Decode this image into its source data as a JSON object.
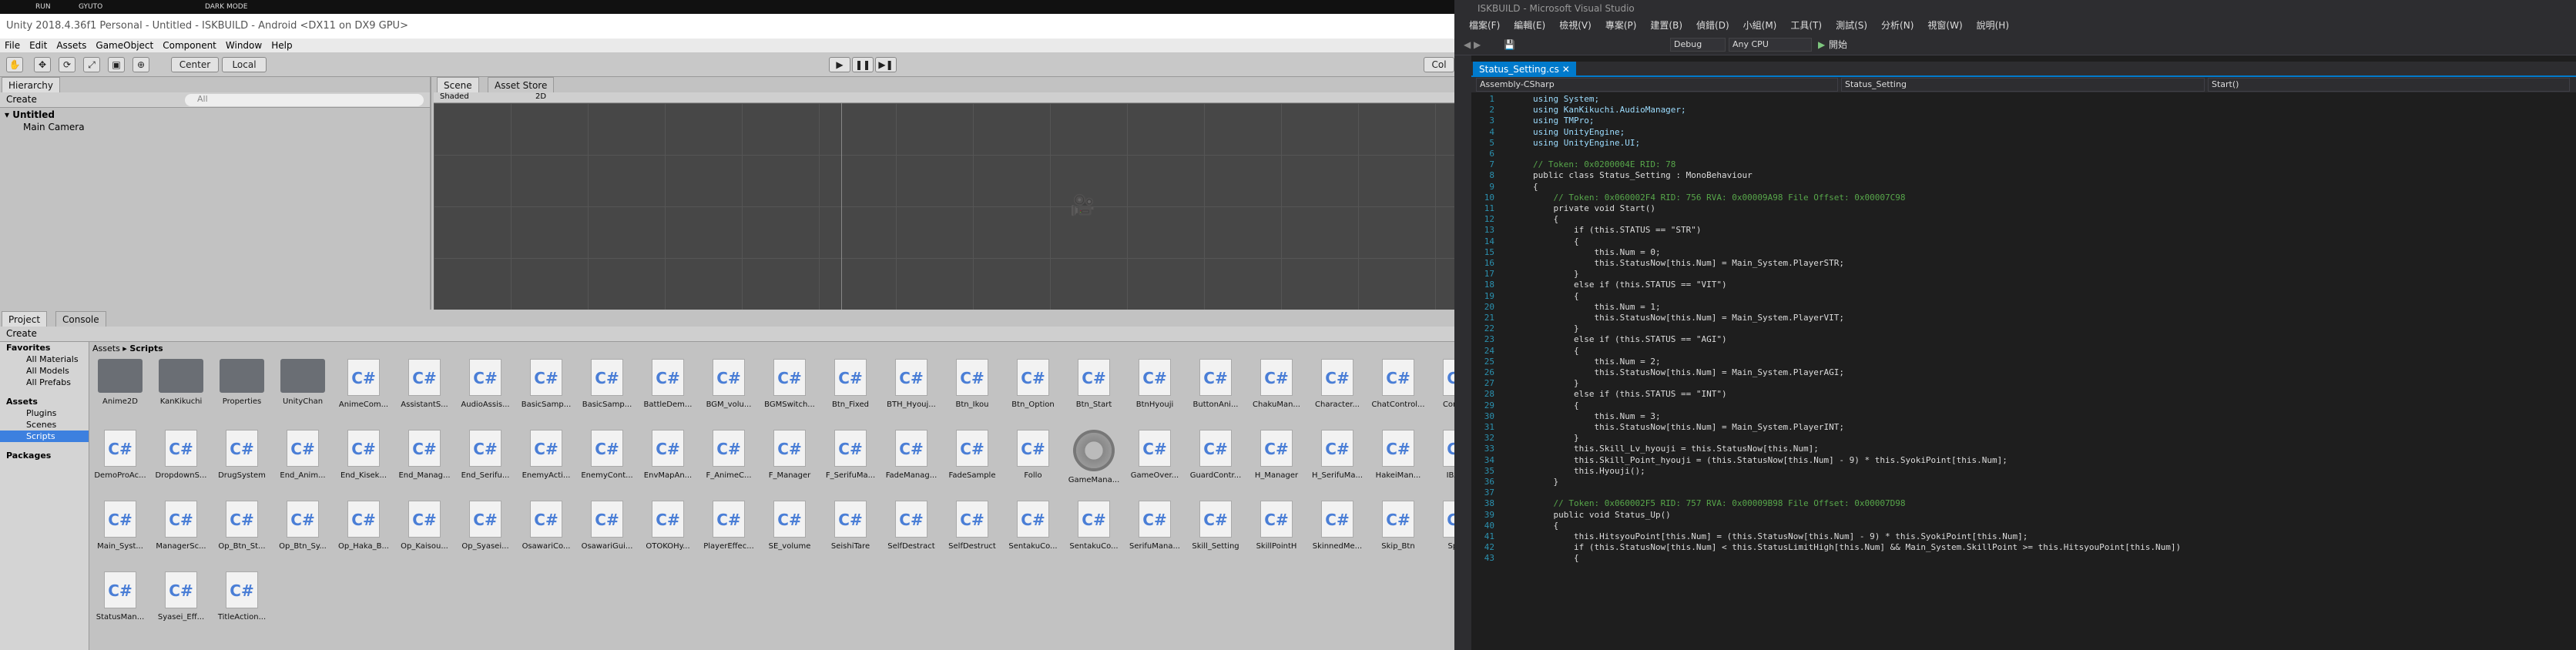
{
  "desktop": {
    "icon_labels": [
      "RUN",
      "GYUTO",
      "",
      "",
      "DARK MODE"
    ]
  },
  "unity": {
    "title": "Unity 2018.4.36f1 Personal - Untitled - ISKBUILD - Android <DX11 on DX9 GPU>",
    "menu": [
      "File",
      "Edit",
      "Assets",
      "GameObject",
      "Component",
      "Window",
      "Help"
    ],
    "toolbar": {
      "center": "Center",
      "local": "Local",
      "collab": "Col"
    },
    "hierarchy": {
      "tab": "Hierarchy",
      "create": "Create",
      "search": "All",
      "scene": "Untitled",
      "items": [
        "Main Camera"
      ]
    },
    "scene": {
      "tab": "Scene",
      "tab2": "Asset Store",
      "shading": "Shaded",
      "mode": "2D"
    },
    "project": {
      "tab": "Project",
      "tab2": "Console",
      "create": "Create",
      "tree": [
        "Favorites",
        "All Materials",
        "All Models",
        "All Prefabs",
        "Assets",
        "Plugins",
        "Scenes",
        "Scripts",
        "Packages"
      ],
      "breadcrumb": [
        "Assets",
        "Scripts"
      ],
      "assets": [
        [
          "Anime2D",
          "KanKikuchi",
          "Properties",
          "UnityChan",
          "AnimeCom...",
          "AssistantS...",
          "AudioAssis...",
          "BasicSamp...",
          "BasicSamp...",
          "BattleDem...",
          "BGM_volu...",
          "BGMSwitch...",
          "Btn_Fixed",
          "BTH_Hyouj...",
          "Btn_Ikou",
          "Btn_Option",
          "Btn_Start",
          "BtnHyouji",
          "ButtonAni...",
          "ChakuMan...",
          "Character...",
          "ChatControl...",
          "Comm..."
        ],
        [
          "DemoProAc...",
          "DropdownS...",
          "DrugSystem",
          "End_Anim...",
          "End_Kisek...",
          "End_Manag...",
          "End_Serifu...",
          "EnemyActi...",
          "EnemyCont...",
          "EnvMapAn...",
          "F_AnimeC...",
          "F_Manager",
          "F_SerifuMa...",
          "FadeManag...",
          "FadeSample",
          "Follo",
          "GameMana...",
          "GameOver...",
          "GuardContr...",
          "H_Manager",
          "H_SerifuMa...",
          "HakeiMan...",
          "IBAR..."
        ],
        [
          "Main_Syst...",
          "ManagerSc...",
          "Op_Btn_St...",
          "Op_Btn_Sy...",
          "Op_Haka_B...",
          "Op_Kaisou...",
          "Op_Syasei...",
          "OsawariCo...",
          "OsawariGui...",
          "OTOKOHy...",
          "PlayerEffec...",
          "SE_volume",
          "SeishiTare",
          "SelfDestract",
          "SelfDestruct",
          "SentakuCo...",
          "SentakuCo...",
          "SerifuMana...",
          "Skill_Setting",
          "SkillPointH",
          "SkinnedMe...",
          "Skip_Btn",
          "Spri..."
        ],
        [
          "StatusMan...",
          "Syasei_Eff...",
          "TitleAction..."
        ]
      ]
    }
  },
  "vs": {
    "title": "ISKBUILD - Microsoft Visual Studio",
    "menu": [
      "檔案(F)",
      "編輯(E)",
      "檢視(V)",
      "專案(P)",
      "建置(B)",
      "偵錯(D)",
      "小組(M)",
      "工具(T)",
      "測試(S)",
      "分析(N)",
      "視窗(W)",
      "說明(H)"
    ],
    "config": "Debug",
    "platform": "Any CPU",
    "start": "開始",
    "tab": "Status_Setting.cs",
    "nav": [
      "Assembly-CSharp",
      "Status_Setting",
      "Start()"
    ],
    "code": [
      "using System;",
      "using KanKikuchi.AudioManager;",
      "using TMPro;",
      "using UnityEngine;",
      "using UnityEngine.UI;",
      "",
      "// Token: 0x0200004E RID: 78",
      "public class Status_Setting : MonoBehaviour",
      "{",
      "    // Token: 0x060002F4 RID: 756 RVA: 0x00009A98 File Offset: 0x00007C98",
      "    private void Start()",
      "    {",
      "        if (this.STATUS == \"STR\")",
      "        {",
      "            this.Num = 0;",
      "            this.StatusNow[this.Num] = Main_System.PlayerSTR;",
      "        }",
      "        else if (this.STATUS == \"VIT\")",
      "        {",
      "            this.Num = 1;",
      "            this.StatusNow[this.Num] = Main_System.PlayerVIT;",
      "        }",
      "        else if (this.STATUS == \"AGI\")",
      "        {",
      "            this.Num = 2;",
      "            this.StatusNow[this.Num] = Main_System.PlayerAGI;",
      "        }",
      "        else if (this.STATUS == \"INT\")",
      "        {",
      "            this.Num = 3;",
      "            this.StatusNow[this.Num] = Main_System.PlayerINT;",
      "        }",
      "        this.Skill_Lv_hyouji = this.StatusNow[this.Num];",
      "        this.Skill_Point_hyouji = (this.StatusNow[this.Num] - 9) * this.SyokiPoint[this.Num];",
      "        this.Hyouji();",
      "    }",
      "",
      "    // Token: 0x060002F5 RID: 757 RVA: 0x00009B98 File Offset: 0x00007D98",
      "    public void Status_Up()",
      "    {",
      "        this.HitsyouPoint[this.Num] = (this.StatusNow[this.Num] - 9) * this.SyokiPoint[this.Num];",
      "        if (this.StatusNow[this.Num] < this.StatusLimitHigh[this.Num] && Main_System.SkillPoint >= this.HitsyouPoint[this.Num])",
      "        {"
    ]
  }
}
